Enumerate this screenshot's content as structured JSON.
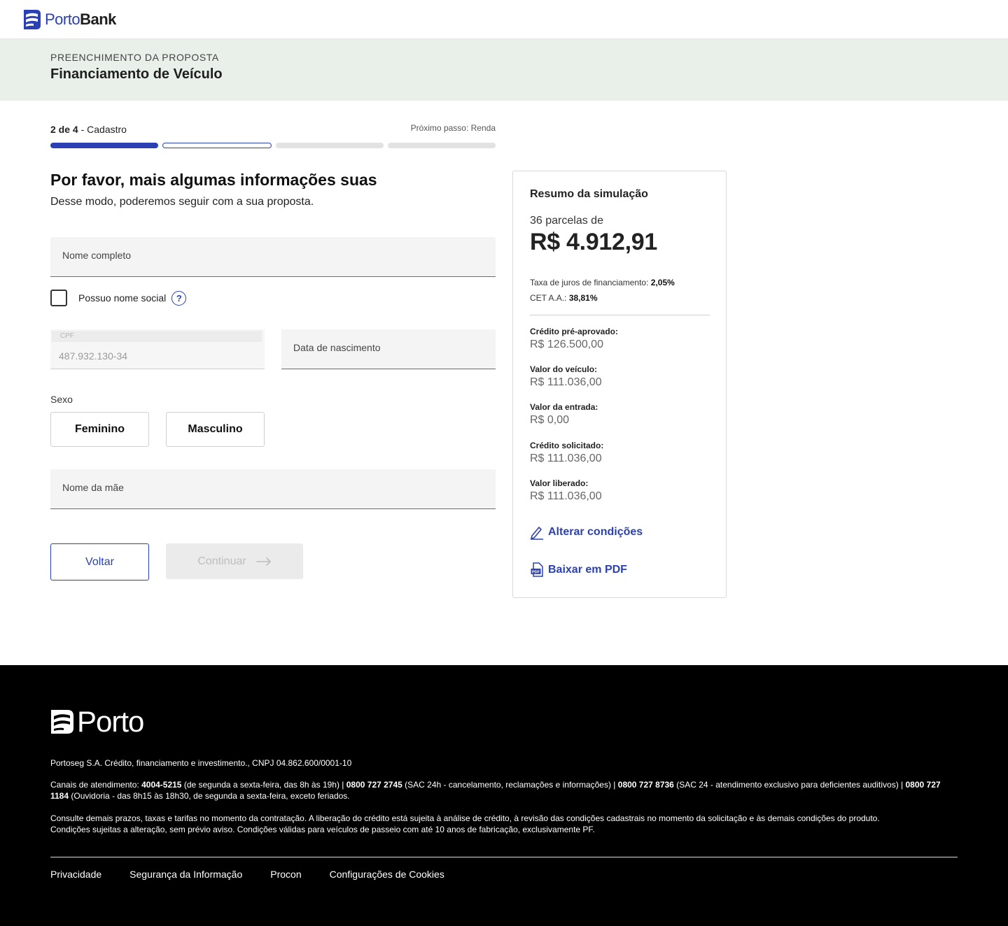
{
  "header": {
    "brand_part1": "Porto",
    "brand_part2": "Bank",
    "brand_icon": "porto-logo-icon"
  },
  "banner": {
    "eyebrow": "PREENCHIMENTO DA PROPOSTA",
    "title": "Financiamento de Veículo"
  },
  "progress": {
    "step_current": "2 de 4",
    "step_name": " - Cadastro",
    "next_step": "Próximo passo: Renda",
    "current": 2,
    "total": 4,
    "accent": "#2b40b3"
  },
  "form": {
    "title": "Por favor, mais algumas informações suas",
    "subtitle": "Desse modo, poderemos seguir com a sua proposta.",
    "name_placeholder": "Nome completo",
    "social_name_label": "Possuo nome social",
    "help_icon": "?",
    "cpf_label": "CPF",
    "cpf_value": "487.932.130-34",
    "birth_placeholder": "Data de nascimento",
    "sex_label": "Sexo",
    "sex_options": [
      "Feminino",
      "Masculino"
    ],
    "mother_placeholder": "Nome da mãe",
    "back_button": "Voltar",
    "continue_button": "Continuar"
  },
  "summary": {
    "title": "Resumo da simulação",
    "installments_label": "36 parcelas de",
    "installment_amount": "R$ 4.912,91",
    "rate_label": "Taxa de juros de financiamento: ",
    "rate_value": "2,05%",
    "cet_label": "CET A.A.: ",
    "cet_value": "38,81%",
    "items": [
      {
        "label": "Crédito pré-aprovado:",
        "value": "R$ 126.500,00"
      },
      {
        "label": "Valor do veículo:",
        "value": "R$ 111.036,00"
      },
      {
        "label": "Valor da entrada:",
        "value": "R$ 0,00"
      },
      {
        "label": "Crédito solicitado:",
        "value": "R$ 111.036,00"
      },
      {
        "label": "Valor liberado:",
        "value": "R$ 111.036,00"
      }
    ],
    "edit_link": "Alterar condições",
    "pdf_link": "Baixar em PDF"
  },
  "footer": {
    "brand": "Porto",
    "company": "Portoseg S.A. Crédito, financiamento e investimento., CNPJ 04.862.600/0001-10",
    "channels": {
      "intro": "Canais de atendimento: ",
      "phone1": "4004-5215",
      "desc1": " (de segunda a sexta-feira, das 8h às 19h) | ",
      "phone2": "0800 727 2745",
      "desc2": " (SAC 24h - cancelamento, reclamações e informações) | ",
      "phone3": "0800 727 8736",
      "desc3": " (SAC 24 - atendimento exclusivo para deficientes auditivos) | ",
      "phone4": "0800 727 1184",
      "desc4": " (Ouvidoria - das 8h15 às 18h30, de segunda a sexta-feira, exceto feriados."
    },
    "disclaimer_line1": "Consulte demais prazos, taxas e tarifas no momento da contratação. A liberação do crédito está sujeita à análise de crédito, à revisão das condições cadastrais no momento da solicitação e às demais condições do produto.",
    "disclaimer_line2": "Condições sujeitas a alteração, sem prévio aviso. Condições válidas para veículos de passeio com até 10 anos de fabricação, exclusivamente PF.",
    "links": [
      "Privacidade",
      "Segurança da Informação",
      "Procon",
      "Configurações de Cookies"
    ]
  }
}
